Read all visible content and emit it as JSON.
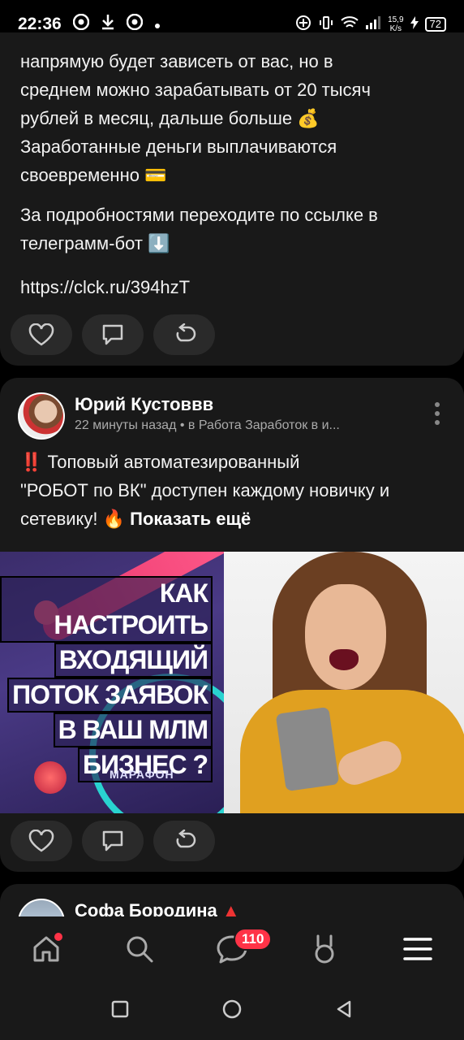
{
  "status": {
    "time": "22:36",
    "net_speed_top": "15,9",
    "net_speed_bottom": "K/s",
    "battery": "72"
  },
  "post1": {
    "text_lines": [
      "напрямую будет зависеть от вас, но в",
      "среднем можно зарабатывать от 20 тысяч",
      "рублей в месяц, дальше больше 💰",
      "Заработанные деньги выплачиваются",
      "своевременно 💳"
    ],
    "text2_lines": [
      "За подробностями переходите по ссылке в",
      "телеграмм-бот ⬇️"
    ],
    "link": "https://clck.ru/394hzT"
  },
  "post2": {
    "author": "Юрий Кустоввв",
    "meta": "22 минуты назад • в Работа Заработок в и...",
    "text_lines": [
      "‼️ Топовый  автоматезированный",
      "\"РОБОТ по ВК\"  доступен каждому новичку и",
      "сетевику! 🔥"
    ],
    "show_more": "Показать ещё",
    "image_title_lines": [
      "КАК НАСТРОИТЬ",
      "ВХОДЯЩИЙ",
      "ПОТОК ЗАЯВОК",
      "В ВАШ МЛМ",
      "БИЗНЕС ?"
    ],
    "image_caption": "МАРАФОН"
  },
  "post3": {
    "author": "Софа Бородина"
  },
  "nav": {
    "messages_badge": "110"
  },
  "colors": {
    "background": "#000000",
    "card": "#191919",
    "button": "#2a2a2a",
    "badge": "#ff3347"
  }
}
